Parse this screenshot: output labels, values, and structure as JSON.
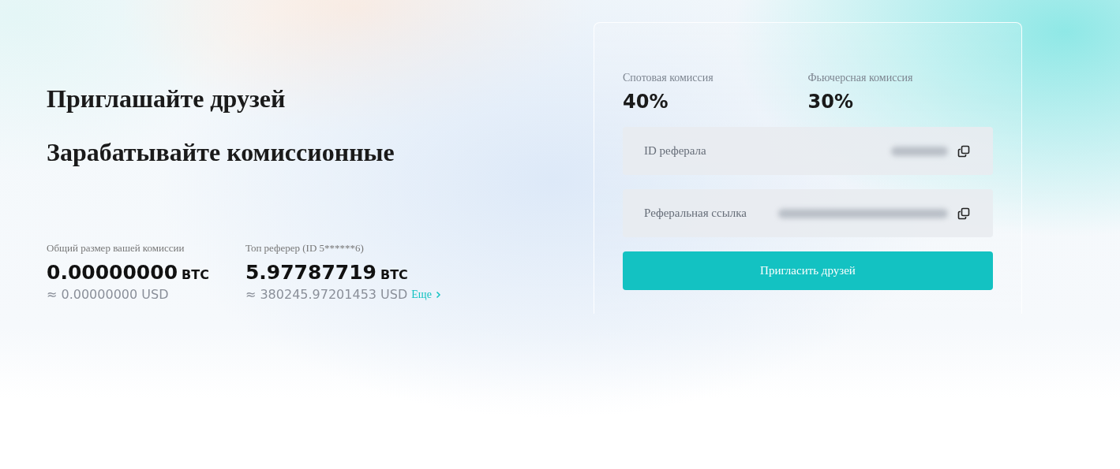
{
  "headings": [
    "Приглашайте друзей",
    "Зарабатывайте комиссионные"
  ],
  "stats": [
    {
      "label": "Общий размер вашей комиссии",
      "amount": "0.00000000",
      "unit": "BTC",
      "usd": "≈ 0.00000000 USD"
    },
    {
      "label": "Топ реферер (ID 5******6)",
      "amount": "5.97787719",
      "unit": "BTC",
      "usd": "≈ 380245.97201453 USD",
      "link": "Еще"
    }
  ],
  "commissions": [
    {
      "label": "Спотовая комиссия",
      "value": "40%"
    },
    {
      "label": "Фьючерсная комиссия",
      "value": "30%"
    }
  ],
  "fields": [
    {
      "label": "ID реферала",
      "kind": "short"
    },
    {
      "label": "Реферальная ссылка",
      "kind": "long"
    }
  ],
  "invite_button": "Пригласить друзей"
}
